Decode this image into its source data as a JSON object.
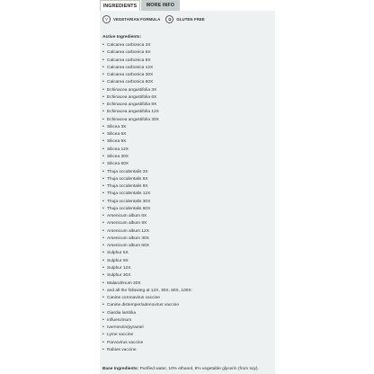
{
  "tabs": [
    {
      "label": "INGREDIENTS",
      "active": true
    },
    {
      "label": "MORE INFO",
      "active": false
    }
  ],
  "badges": [
    {
      "icon": "leaf-v-icon",
      "glyph": "V",
      "label": "VEGETARIAN FORMULA"
    },
    {
      "icon": "wheat-icon",
      "glyph": "✿",
      "label": "GLUTEN FREE"
    }
  ],
  "active_heading": "Active Ingredients:",
  "ingredients": [
    "Calcarea carbonica 3X",
    "Calcarea carbonica 6X",
    "Calcarea carbonica 9X",
    "Calcarea carbonica 12X",
    "Calcarea carbonica 30X",
    "Calcarea carbonica 60X",
    "Echinacea angustifolia 3X",
    "Echinacea angustifolia 6X",
    "Echinacea angustifolia 9X",
    "Echinacea angustifolia 12X",
    "Echinacea angustifolia 30X",
    "Silicea 3X",
    "Silicea 6X",
    "Silicea 9X",
    "Silicea 12X",
    "Silicea 30X",
    "Silicea 60X",
    "Thuja occidentalis 3X",
    "Thuja occidentalis 6X",
    "Thuja occidentalis 9X",
    "Thuja occidentalis 12X",
    "Thuja occidentalis 30X",
    "Thuja occidentalis 60X",
    "Arsenicum album 6X",
    "Arsenicum album 9X",
    "Arsenicum album 12X",
    "Arsenicum album 30X",
    "Arsenicum album 60X",
    "Sulphur 6X",
    "Sulphur 9X",
    "Sulphur 12X",
    "Sulphur 30X",
    "Malandrinum 30X",
    "and all the following at 12X, 30X, 60X, 100X:",
    "Canine coronavirus vaccine",
    "Canine distemper/adenovirus vaccine",
    "Giardia lamblia",
    "Influenzinum",
    "Ivermectin/pyrantel",
    "Lyme vaccine",
    "Parvovirus vaccine",
    "Rabies vaccine"
  ],
  "base": {
    "label": "Base Ingredients:",
    "text": " Purified water, 10% ethanol, 8% vegetable glycerin (from soy)."
  },
  "colors": {
    "panel_bg": "#edf1f1",
    "inactive_tab_bg": "#c5cdcd"
  }
}
